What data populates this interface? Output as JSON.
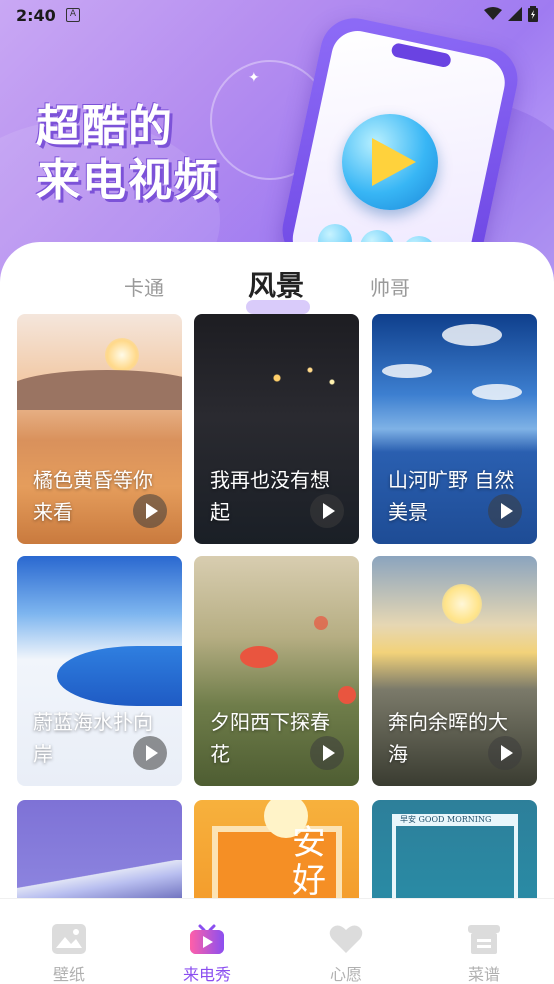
{
  "status_bar": {
    "time": "2:40"
  },
  "banner": {
    "headline_line1": "超酷的",
    "headline_line2": "来电视频"
  },
  "tabs": [
    {
      "label": "卡通",
      "active": false
    },
    {
      "label": "风景",
      "active": true
    },
    {
      "label": "帅哥",
      "active": false
    }
  ],
  "cards": [
    {
      "title": "橘色黄昏等你来看"
    },
    {
      "title": "我再也没有想起"
    },
    {
      "title": "山河旷野 自然美景"
    },
    {
      "title": "蔚蓝海水扑向岸"
    },
    {
      "title": "夕阳西下探春花"
    },
    {
      "title": "奔向余晖的大海"
    },
    {
      "title": ""
    },
    {
      "title": "",
      "overlay_text": "安好"
    },
    {
      "title": "",
      "overlay_text": "早安 GOOD MORNING"
    }
  ],
  "bottom_nav": [
    {
      "label": "壁纸",
      "icon": "image-icon",
      "active": false
    },
    {
      "label": "来电秀",
      "icon": "tv-play-icon",
      "active": true
    },
    {
      "label": "心愿",
      "icon": "heart-icon",
      "active": false
    },
    {
      "label": "菜谱",
      "icon": "recipe-icon",
      "active": false
    }
  ],
  "colors": {
    "accent": "#8b4ff0",
    "banner": "#b58ef0"
  }
}
